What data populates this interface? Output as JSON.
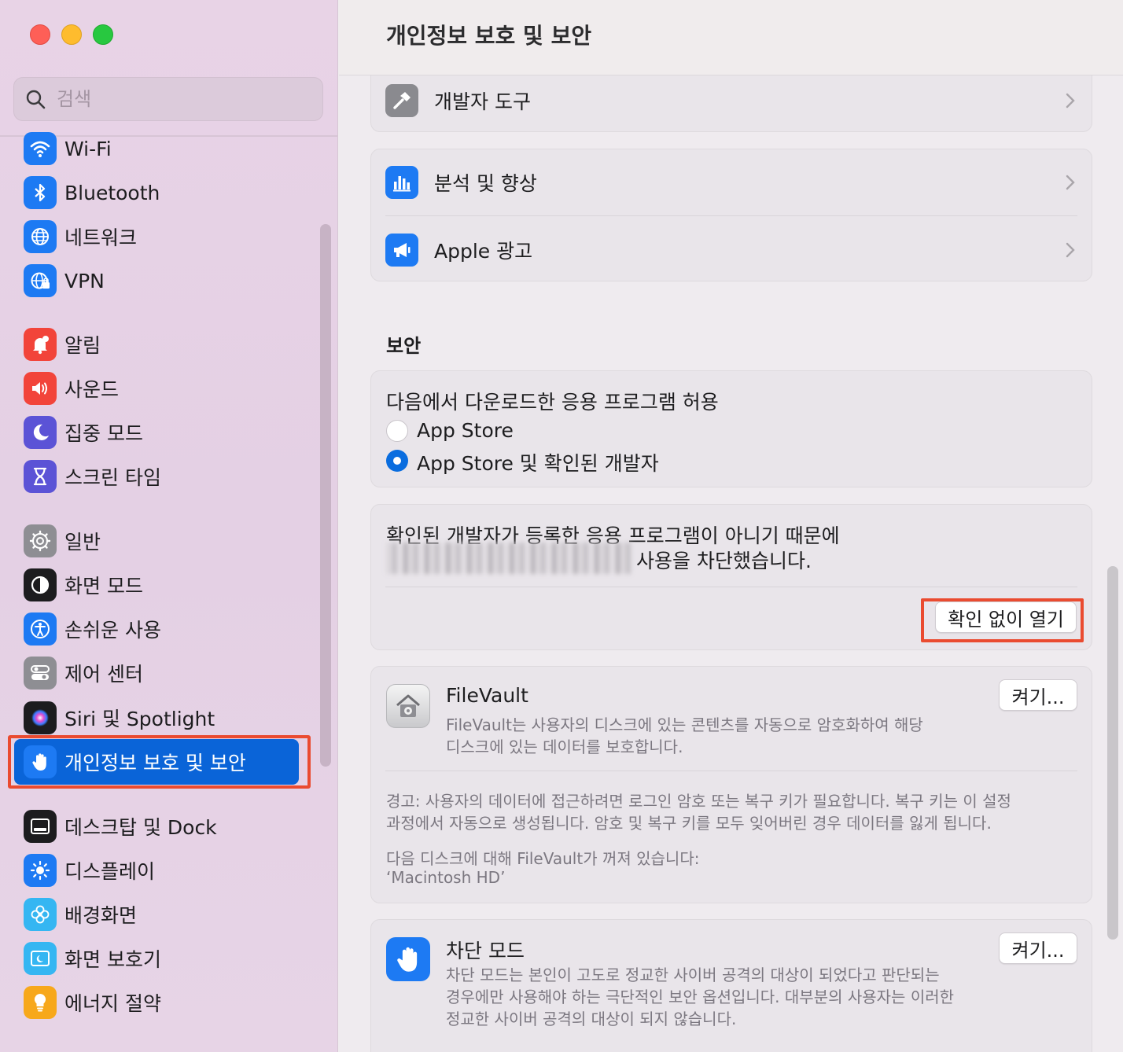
{
  "window": {
    "title": "개인정보 보호 및 보안"
  },
  "search": {
    "placeholder": "검색"
  },
  "sidebar": {
    "items": [
      {
        "label": "Wi-Fi",
        "icon": "wifi-icon",
        "color": "#1d7af3"
      },
      {
        "label": "Bluetooth",
        "icon": "bluetooth-icon",
        "color": "#1d7af3"
      },
      {
        "label": "네트워크",
        "icon": "globe-icon",
        "color": "#1d7af3"
      },
      {
        "label": "VPN",
        "icon": "vpn-globe-icon",
        "color": "#1d7af3"
      },
      {
        "label": "알림",
        "icon": "bell-icon",
        "color": "#f2443a"
      },
      {
        "label": "사운드",
        "icon": "speaker-icon",
        "color": "#f2443a"
      },
      {
        "label": "집중 모드",
        "icon": "moon-icon",
        "color": "#5b53d6"
      },
      {
        "label": "스크린 타임",
        "icon": "hourglass-icon",
        "color": "#5b53d6"
      },
      {
        "label": "일반",
        "icon": "gear-icon",
        "color": "#8e8e93"
      },
      {
        "label": "화면 모드",
        "icon": "appearance-icon",
        "color": "#1c1c1e"
      },
      {
        "label": "손쉬운 사용",
        "icon": "accessibility-icon",
        "color": "#1d7af3"
      },
      {
        "label": "제어 센터",
        "icon": "toggles-icon",
        "color": "#8e8e93"
      },
      {
        "label": "Siri 및 Spotlight",
        "icon": "siri-icon",
        "color": "#1c1c1e"
      },
      {
        "label": "개인정보 보호 및 보안",
        "icon": "hand-icon",
        "color": "#1d7af3",
        "selected": true
      },
      {
        "label": "데스크탑 및 Dock",
        "icon": "dock-icon",
        "color": "#1c1c1e"
      },
      {
        "label": "디스플레이",
        "icon": "sun-icon",
        "color": "#1d7af3"
      },
      {
        "label": "배경화면",
        "icon": "flower-icon",
        "color": "#35b6f2"
      },
      {
        "label": "화면 보호기",
        "icon": "screensaver-icon",
        "color": "#35b6f2"
      },
      {
        "label": "에너지 절약",
        "icon": "bulb-icon",
        "color": "#f7a81b"
      }
    ]
  },
  "main": {
    "dev_tools": "개발자 도구",
    "analytics": "분석 및 향상",
    "apple_ads": "Apple 광고",
    "security_title": "보안",
    "allow_title": "다음에서 다운로드한 응용 프로그램 허용",
    "radio_appstore": "App Store",
    "radio_identified": "App Store 및 확인된 개발자",
    "blocked_line1": "확인된 개발자가 등록한 응용 프로그램이 아니기 때문에",
    "blocked_line2": "사용을 차단했습니다.",
    "open_anyway": "확인 없이 열기",
    "filevault_title": "FileVault",
    "filevault_desc1": "FileVault는 사용자의 디스크에 있는 콘텐츠를 자동으로 암호화하여 해당",
    "filevault_desc2": "디스크에 있는 데이터를 보호합니다.",
    "filevault_button": "켜기...",
    "warning1": "경고: 사용자의 데이터에 접근하려면 로그인 암호 또는 복구 키가 필요합니다. 복구 키는 이 설정",
    "warning2": "과정에서 자동으로 생성됩니다. 암호 및 복구 키를 모두 잊어버린 경우 데이터를 잃게 됩니다.",
    "disk_status": "다음 디스크에 대해 FileVault가 꺼져 있습니다:",
    "disk_name": "‘Macintosh HD’",
    "lockdown_title": "차단 모드",
    "lockdown_button": "켜기...",
    "lockdown_desc1": "차단 모드는 본인이 고도로 정교한 사이버 공격의 대상이 되었다고 판단되는",
    "lockdown_desc2": "경우에만 사용해야 하는 극단적인 보안 옵션입니다. 대부분의 사용자는 이러한",
    "lockdown_desc3": "정교한 사이버 공격의 대상이 되지 않습니다."
  }
}
